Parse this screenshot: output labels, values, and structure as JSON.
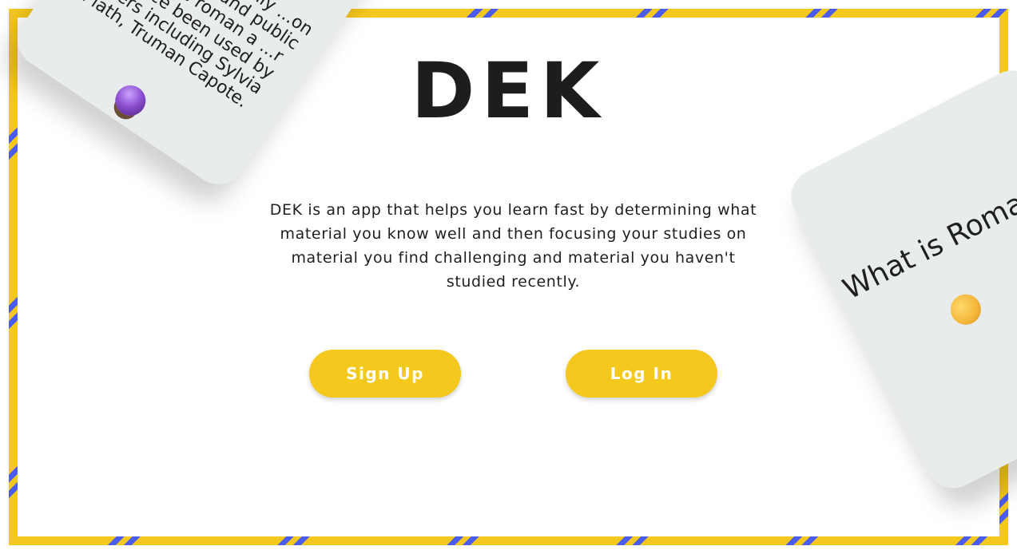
{
  "app": {
    "title": "DEK",
    "description": "DEK is an app that helps you learn fast by determining what material you know well and then focusing your studies on material you find challenging and material you haven't studied recently."
  },
  "buttons": {
    "signup_label": "Sign Up",
    "login_label": "Log In"
  },
  "cards": {
    "left": {
      "text": "...provide ...er thinly ...on featuring ...al and public ...ures, the roman a ...r has since been used by writers including Sylvia Plath, Truman Capote.",
      "emoji": "crystal-ball-icon"
    },
    "right": {
      "text": "What is Roman à c",
      "emoji": "thinking-face-icon"
    }
  },
  "colors": {
    "accent_yellow": "#f5c81d",
    "stripe_blue": "#4b5cf0",
    "card_gray": "#e9eced",
    "text_dark": "#1d1d1d"
  }
}
